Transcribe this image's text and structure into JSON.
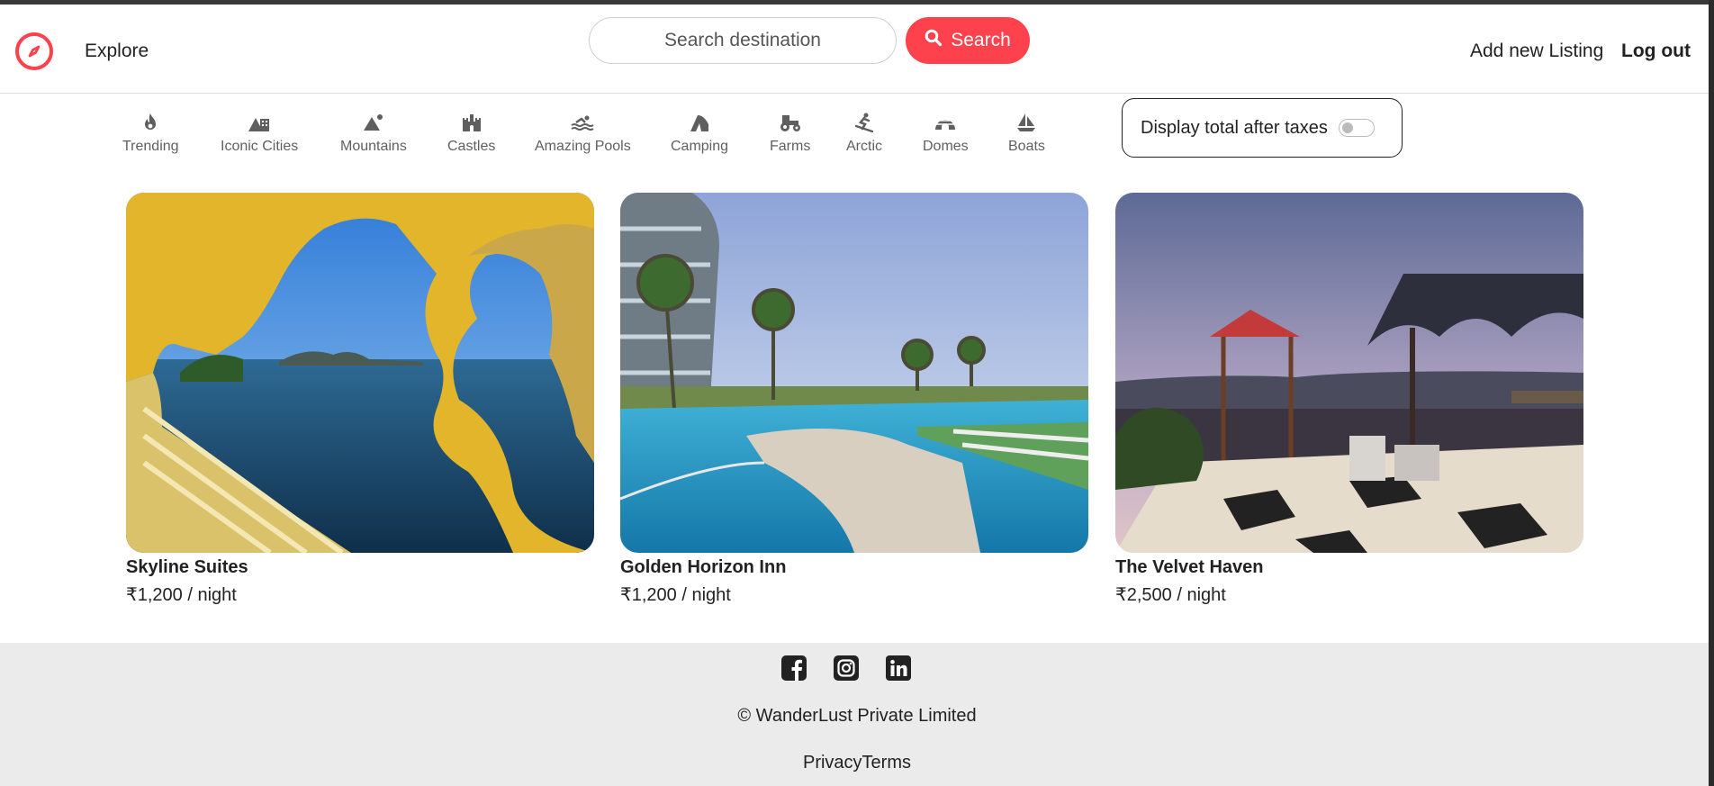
{
  "header": {
    "explore_label": "Explore",
    "search_placeholder": "Search destination",
    "search_button_label": "Search",
    "add_listing_label": "Add new Listing",
    "logout_label": "Log out"
  },
  "filters": [
    {
      "label": "Trending",
      "icon": "fire-icon"
    },
    {
      "label": "Iconic Cities",
      "icon": "city-icon"
    },
    {
      "label": "Mountains",
      "icon": "mountain-icon"
    },
    {
      "label": "Castles",
      "icon": "castle-icon"
    },
    {
      "label": "Amazing Pools",
      "icon": "pool-icon"
    },
    {
      "label": "Camping",
      "icon": "tent-icon"
    },
    {
      "label": "Farms",
      "icon": "tractor-icon"
    },
    {
      "label": "Arctic",
      "icon": "snowboard-icon"
    },
    {
      "label": "Domes",
      "icon": "igloo-icon"
    },
    {
      "label": "Boats",
      "icon": "sailboat-icon"
    }
  ],
  "tax_toggle": {
    "label": "Display total after taxes",
    "enabled": false
  },
  "listings": [
    {
      "title": "Skyline Suites",
      "price": "₹1,200 / night"
    },
    {
      "title": "Golden Horizon Inn",
      "price": "₹1,200 / night"
    },
    {
      "title": "The Velvet Haven",
      "price": "₹2,500 / night"
    }
  ],
  "footer": {
    "socials": [
      "facebook-icon",
      "instagram-icon",
      "linkedin-icon"
    ],
    "copyright": "© WanderLust Private Limited",
    "links": "PrivacyTerms"
  },
  "colors": {
    "accent": "#fe424d",
    "footer_bg": "#ebebeb"
  }
}
